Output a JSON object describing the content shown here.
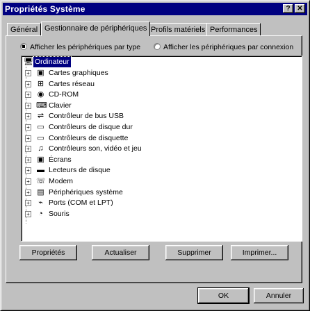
{
  "window": {
    "title": "Propriétés Système",
    "help_btn": "?",
    "close_btn": "✕"
  },
  "tabs": [
    {
      "label": "Général"
    },
    {
      "label": "Gestionnaire de périphériques"
    },
    {
      "label": "Profils matériels"
    },
    {
      "label": "Performances"
    }
  ],
  "view": {
    "by_type": "Afficher les périphériques par type",
    "by_connection": "Afficher les périphériques par connexion",
    "selected": "by_type"
  },
  "tree": {
    "root": "Ordinateur",
    "items": [
      {
        "label": "Cartes graphiques",
        "icon": "display-adapter-icon"
      },
      {
        "label": "Cartes réseau",
        "icon": "network-adapter-icon"
      },
      {
        "label": "CD-ROM",
        "icon": "cdrom-icon"
      },
      {
        "label": "Clavier",
        "icon": "keyboard-icon"
      },
      {
        "label": "Contrôleur de bus USB",
        "icon": "usb-icon"
      },
      {
        "label": "Contrôleurs de disque dur",
        "icon": "hard-disk-controller-icon"
      },
      {
        "label": "Contrôleurs de disquette",
        "icon": "floppy-controller-icon"
      },
      {
        "label": "Contrôleurs son, vidéo et jeu",
        "icon": "sound-video-game-icon"
      },
      {
        "label": "Écrans",
        "icon": "monitor-icon"
      },
      {
        "label": "Lecteurs de disque",
        "icon": "disk-drive-icon"
      },
      {
        "label": "Modem",
        "icon": "modem-icon"
      },
      {
        "label": "Périphériques système",
        "icon": "system-devices-icon"
      },
      {
        "label": "Ports (COM et LPT)",
        "icon": "ports-icon"
      },
      {
        "label": "Souris",
        "icon": "mouse-icon"
      }
    ]
  },
  "buttons": {
    "properties": "Propriétés",
    "refresh": "Actualiser",
    "remove": "Supprimer",
    "print": "Imprimer...",
    "ok": "OK",
    "cancel": "Annuler"
  },
  "colors": {
    "titlebar": "#000080",
    "face": "#c0c0c0",
    "selection": "#000080"
  }
}
